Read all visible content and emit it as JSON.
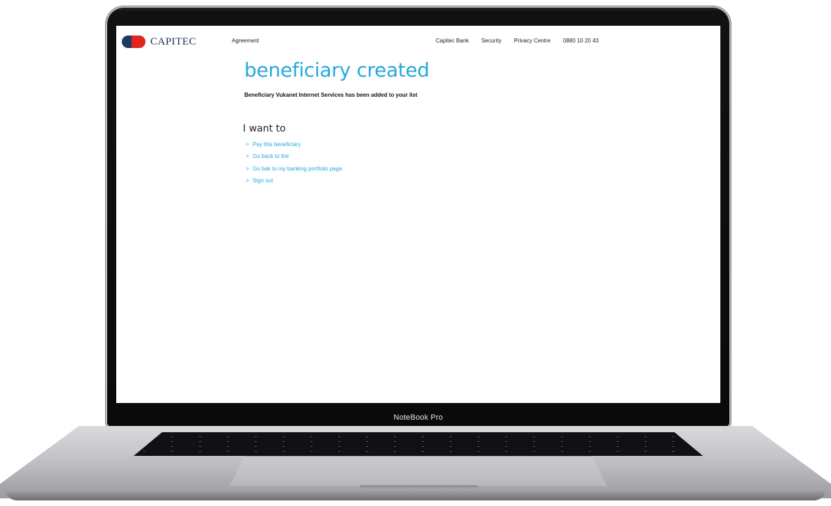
{
  "device": {
    "label": "NoteBook Pro"
  },
  "header": {
    "logo_text": "CAPITEC",
    "nav_left": "Agreement",
    "nav_right": [
      "Capitec Bank",
      "Security",
      "Privacy Centre",
      "0880 10 20 43"
    ]
  },
  "main": {
    "title": "beneficiary created",
    "message": "Beneficiary Vukanet Internet Services has been added to your list",
    "section_title": "I want to",
    "links": [
      {
        "chevron": ">",
        "label": "Pay this beneficiary"
      },
      {
        "chevron": ">",
        "label": "Go back to the"
      },
      {
        "chevron": ">",
        "label": "Go bak to my banking portfolio page"
      },
      {
        "chevron": ">",
        "label": "Sign out"
      }
    ]
  },
  "colors": {
    "accent": "#27a8dd",
    "brand_navy": "#1c3a63",
    "brand_red": "#e1261c"
  },
  "icons": {
    "logo": "capitec-logo-icon",
    "link_chevron": "chevron-right-icon"
  }
}
